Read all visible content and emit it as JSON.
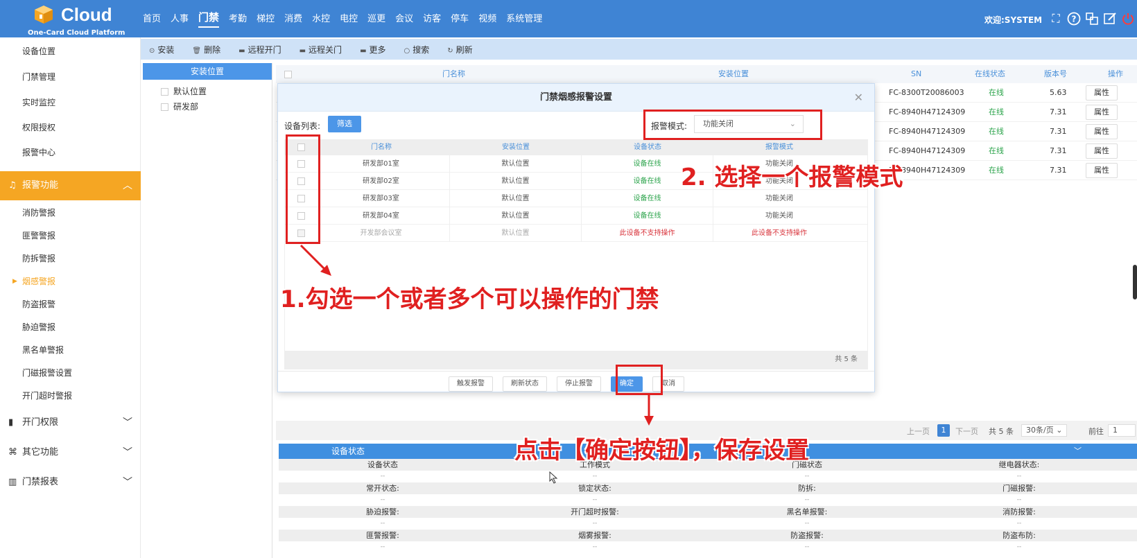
{
  "header": {
    "logo_text": "Cloud",
    "logo_sub": "One-Card Cloud Platform",
    "nav": [
      "首页",
      "人事",
      "门禁",
      "考勤",
      "梯控",
      "消费",
      "水控",
      "电控",
      "巡更",
      "会议",
      "访客",
      "停车",
      "视频",
      "系统管理"
    ],
    "active_nav": "门禁",
    "welcome": "欢迎:SYSTEM"
  },
  "sidebar": {
    "top_items": [
      "设备位置",
      "门禁管理",
      "实时监控",
      "权限授权",
      "报警中心"
    ],
    "active_group": "报警功能",
    "alarm_items": [
      "消防警报",
      "匪警警报",
      "防拆警报",
      "烟感警报",
      "防盗报警",
      "胁迫警报",
      "黑名单警报",
      "门磁报警设置",
      "开门超时警报"
    ],
    "active_item": "烟感警报",
    "groups": [
      "开门权限",
      "其它功能",
      "门禁报表"
    ]
  },
  "toolbar": [
    "安装",
    "删除",
    "远程开门",
    "远程关门",
    "更多",
    "搜索",
    "刷新"
  ],
  "tree": {
    "title": "安装位置",
    "nodes": [
      "默认位置",
      "研发部"
    ]
  },
  "main_table": {
    "headers": [
      "门名称",
      "安装位置",
      "SN",
      "在线状态",
      "版本号",
      "操作"
    ],
    "rows": [
      {
        "sn": "FC-8300T20086003",
        "status": "在线",
        "version": "5.63",
        "action": "属性"
      },
      {
        "sn": "FC-8940H47124309",
        "status": "在线",
        "version": "7.31",
        "action": "属性"
      },
      {
        "sn": "FC-8940H47124309",
        "status": "在线",
        "version": "7.31",
        "action": "属性"
      },
      {
        "sn": "FC-8940H47124309",
        "status": "在线",
        "version": "7.31",
        "action": "属性"
      },
      {
        "sn": "FC-8940H47124309",
        "status": "在线",
        "version": "7.31",
        "action": "属性"
      }
    ]
  },
  "pager": {
    "prev": "上一页",
    "current": "1",
    "next": "下一页",
    "total": "共 5 条",
    "page_size": "30条/页",
    "goto_label": "前往",
    "goto_value": "1"
  },
  "device_status": {
    "title": "设备状态",
    "rows": [
      [
        "设备状态",
        "工作模式",
        "门磁状态",
        "继电器状态:"
      ],
      [
        "常开状态:",
        "锁定状态:",
        "防拆:",
        "门磁报警:"
      ],
      [
        "胁迫报警:",
        "开门超时报警:",
        "黑名单报警:",
        "消防报警:"
      ],
      [
        "匪警报警:",
        "烟雾报警:",
        "防盗报警:",
        "防盗布防:"
      ]
    ],
    "placeholder": "--"
  },
  "modal": {
    "title": "门禁烟感报警设置",
    "device_list_label": "设备列表:",
    "filter_button": "筛选",
    "mode_label": "报警模式:",
    "mode_value": "功能关闭",
    "headers": [
      "门名称",
      "安装位置",
      "设备状态",
      "报警模式"
    ],
    "rows": [
      {
        "name": "研发部01室",
        "location": "默认位置",
        "status": "设备在线",
        "mode": "功能关闭",
        "supported": true
      },
      {
        "name": "研发部02室",
        "location": "默认位置",
        "status": "设备在线",
        "mode": "功能关闭",
        "supported": true
      },
      {
        "name": "研发部03室",
        "location": "默认位置",
        "status": "设备在线",
        "mode": "功能关闭",
        "supported": true
      },
      {
        "name": "研发部04室",
        "location": "默认位置",
        "status": "设备在线",
        "mode": "功能关闭",
        "supported": true
      },
      {
        "name": "开发部会议室",
        "location": "默认位置",
        "status": "此设备不支持操作",
        "mode": "此设备不支持操作",
        "supported": false
      }
    ],
    "total": "共 5 条",
    "buttons": {
      "trigger": "触发报警",
      "refresh": "刷新状态",
      "stop": "停止报警",
      "confirm": "确定",
      "cancel": "取消"
    }
  },
  "annotations": {
    "step1": "1.勾选一个或者多个可以操作的门禁",
    "step2": "2. 选择一个报警模式",
    "step3": "点击【确定按钮】，保存设置"
  },
  "colors": {
    "topbar": "#3f84d4",
    "accent": "#f5a623",
    "primary_button": "#4c96e8",
    "annotation_red": "#e02020",
    "online_green": "#2aa34a"
  }
}
